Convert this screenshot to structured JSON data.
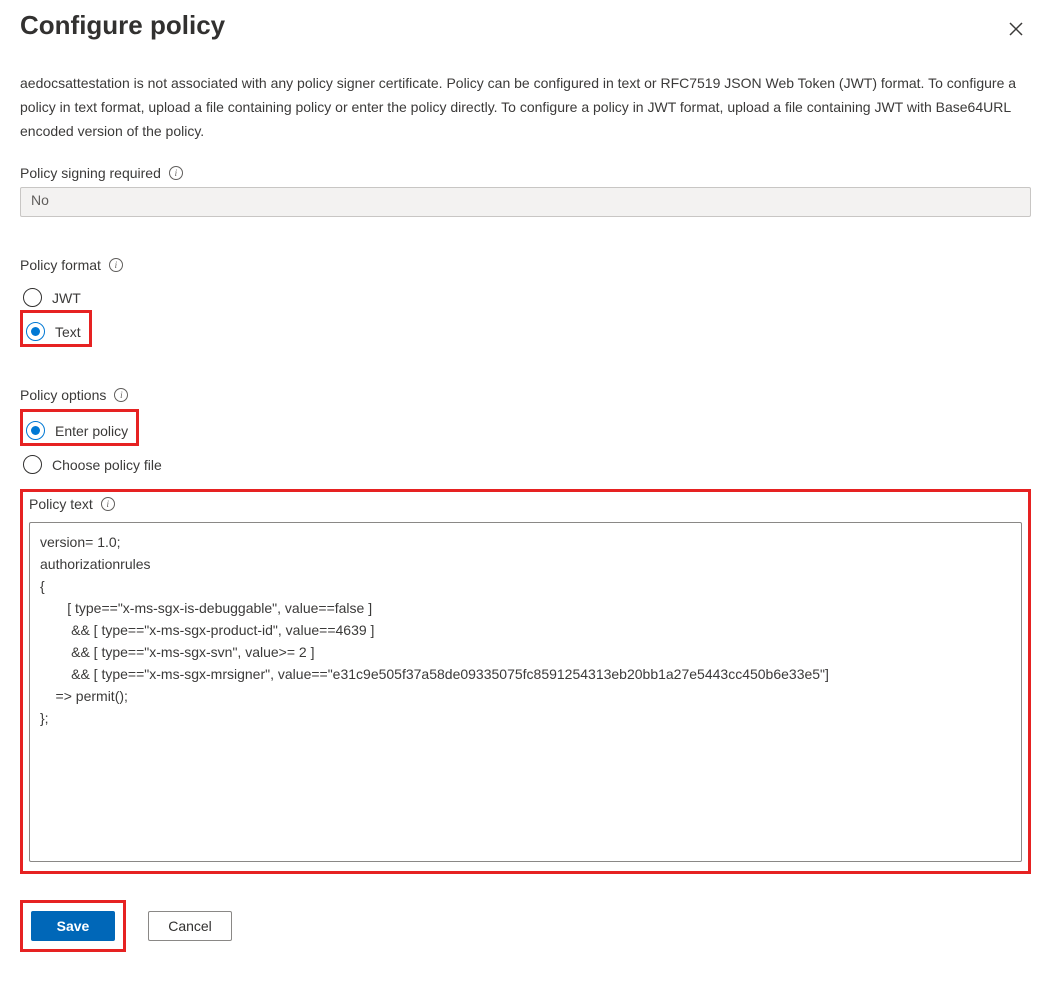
{
  "header": {
    "title": "Configure policy"
  },
  "description": "aedocsattestation is not associated with any policy signer certificate. Policy can be configured in text or RFC7519 JSON Web Token (JWT) format. To configure a policy in text format, upload a file containing policy or enter the policy directly. To configure a policy in JWT format, upload a file containing JWT with Base64URL encoded version of the policy.",
  "signing": {
    "label": "Policy signing required",
    "value": "No"
  },
  "format": {
    "label": "Policy format",
    "options": {
      "jwt": "JWT",
      "text": "Text"
    },
    "selected": "text"
  },
  "options": {
    "label": "Policy options",
    "options": {
      "enter": "Enter policy",
      "choose": "Choose policy file"
    },
    "selected": "enter"
  },
  "policy_text": {
    "label": "Policy text",
    "value": "version= 1.0;\nauthorizationrules\n{\n       [ type==\"x-ms-sgx-is-debuggable\", value==false ]\n        && [ type==\"x-ms-sgx-product-id\", value==4639 ]\n        && [ type==\"x-ms-sgx-svn\", value>= 2 ]\n        && [ type==\"x-ms-sgx-mrsigner\", value==\"e31c9e505f37a58de09335075fc8591254313eb20bb1a27e5443cc450b6e33e5\"]\n    => permit();\n};"
  },
  "buttons": {
    "save": "Save",
    "cancel": "Cancel"
  }
}
